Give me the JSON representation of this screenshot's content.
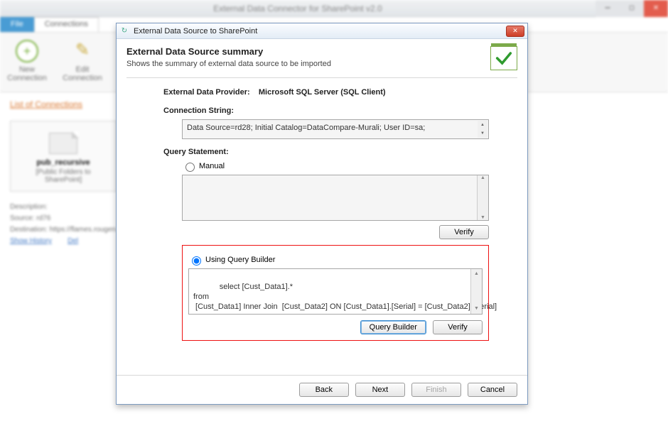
{
  "app": {
    "title": "External Data Connector for SharePoint v2.0",
    "tabs": {
      "file": "File",
      "connections": "Connections"
    },
    "ribbon": {
      "new_conn": "New\nConnection",
      "edit_conn": "Edit\nConnection"
    },
    "list_link": "List of Connections",
    "card": {
      "title": "pub_recursive",
      "subtitle": "[Public Folders to SharePoint]"
    },
    "meta": {
      "desc_label": "Description:",
      "source_label": "Source: rd76",
      "dest_label": "Destination: https://flames.rougen...",
      "show": "Show History",
      "del": "Del"
    }
  },
  "modal": {
    "title": "External Data Source to SharePoint",
    "summary_title": "External Data Source summary",
    "summary_sub": "Shows the summary of external data source to be imported",
    "provider_label": "External Data Provider:",
    "provider_value": "Microsoft SQL Server (SQL Client)",
    "conn_label": "Connection String:",
    "conn_value": "Data Source=rd28; Initial Catalog=DataCompare-Murali; User ID=sa;",
    "query_label": "Query Statement:",
    "radio_manual": "Manual",
    "radio_builder": "Using Query Builder",
    "verify": "Verify",
    "builder_btn": "Query Builder",
    "query_text": "select [Cust_Data1].*\nfrom\n [Cust_Data1] Inner Join  [Cust_Data2] ON [Cust_Data1].[Serial] = [Cust_Data2].[Serial]",
    "footer": {
      "back": "Back",
      "next": "Next",
      "finish": "Finish",
      "cancel": "Cancel"
    }
  }
}
